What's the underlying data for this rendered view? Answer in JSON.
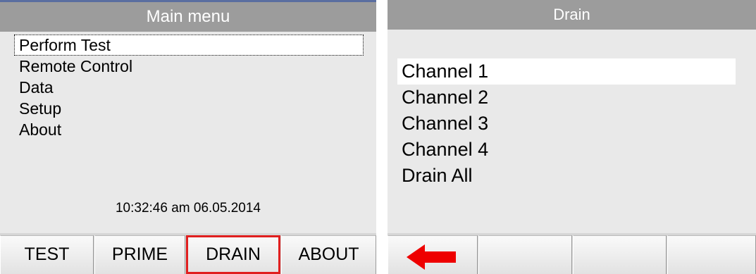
{
  "left_screen": {
    "title": "Main menu",
    "menu_items": [
      {
        "label": "Perform Test",
        "selected": true
      },
      {
        "label": "Remote Control",
        "selected": false
      },
      {
        "label": "Data",
        "selected": false
      },
      {
        "label": "Setup",
        "selected": false
      },
      {
        "label": "About",
        "selected": false
      }
    ],
    "datetime": "10:32:46 am 06.05.2014",
    "buttons": [
      {
        "label": "TEST"
      },
      {
        "label": "PRIME"
      },
      {
        "label": "DRAIN",
        "highlighted": true
      },
      {
        "label": "ABOUT"
      }
    ]
  },
  "right_screen": {
    "title": "Drain",
    "menu_items": [
      {
        "label": "Channel 1",
        "selected": true
      },
      {
        "label": "Channel 2",
        "selected": false
      },
      {
        "label": "Channel 3",
        "selected": false
      },
      {
        "label": "Channel 4",
        "selected": false
      },
      {
        "label": "Drain All",
        "selected": false
      }
    ],
    "buttons": [
      {
        "icon": "back-arrow-icon"
      },
      {
        "label": ""
      },
      {
        "label": ""
      },
      {
        "label": ""
      }
    ]
  },
  "colors": {
    "title_bar": "#9c9c9c",
    "screen_background": "#e9e9e9",
    "highlight_outline": "#e01f1f",
    "back_arrow": "#ee0000"
  }
}
